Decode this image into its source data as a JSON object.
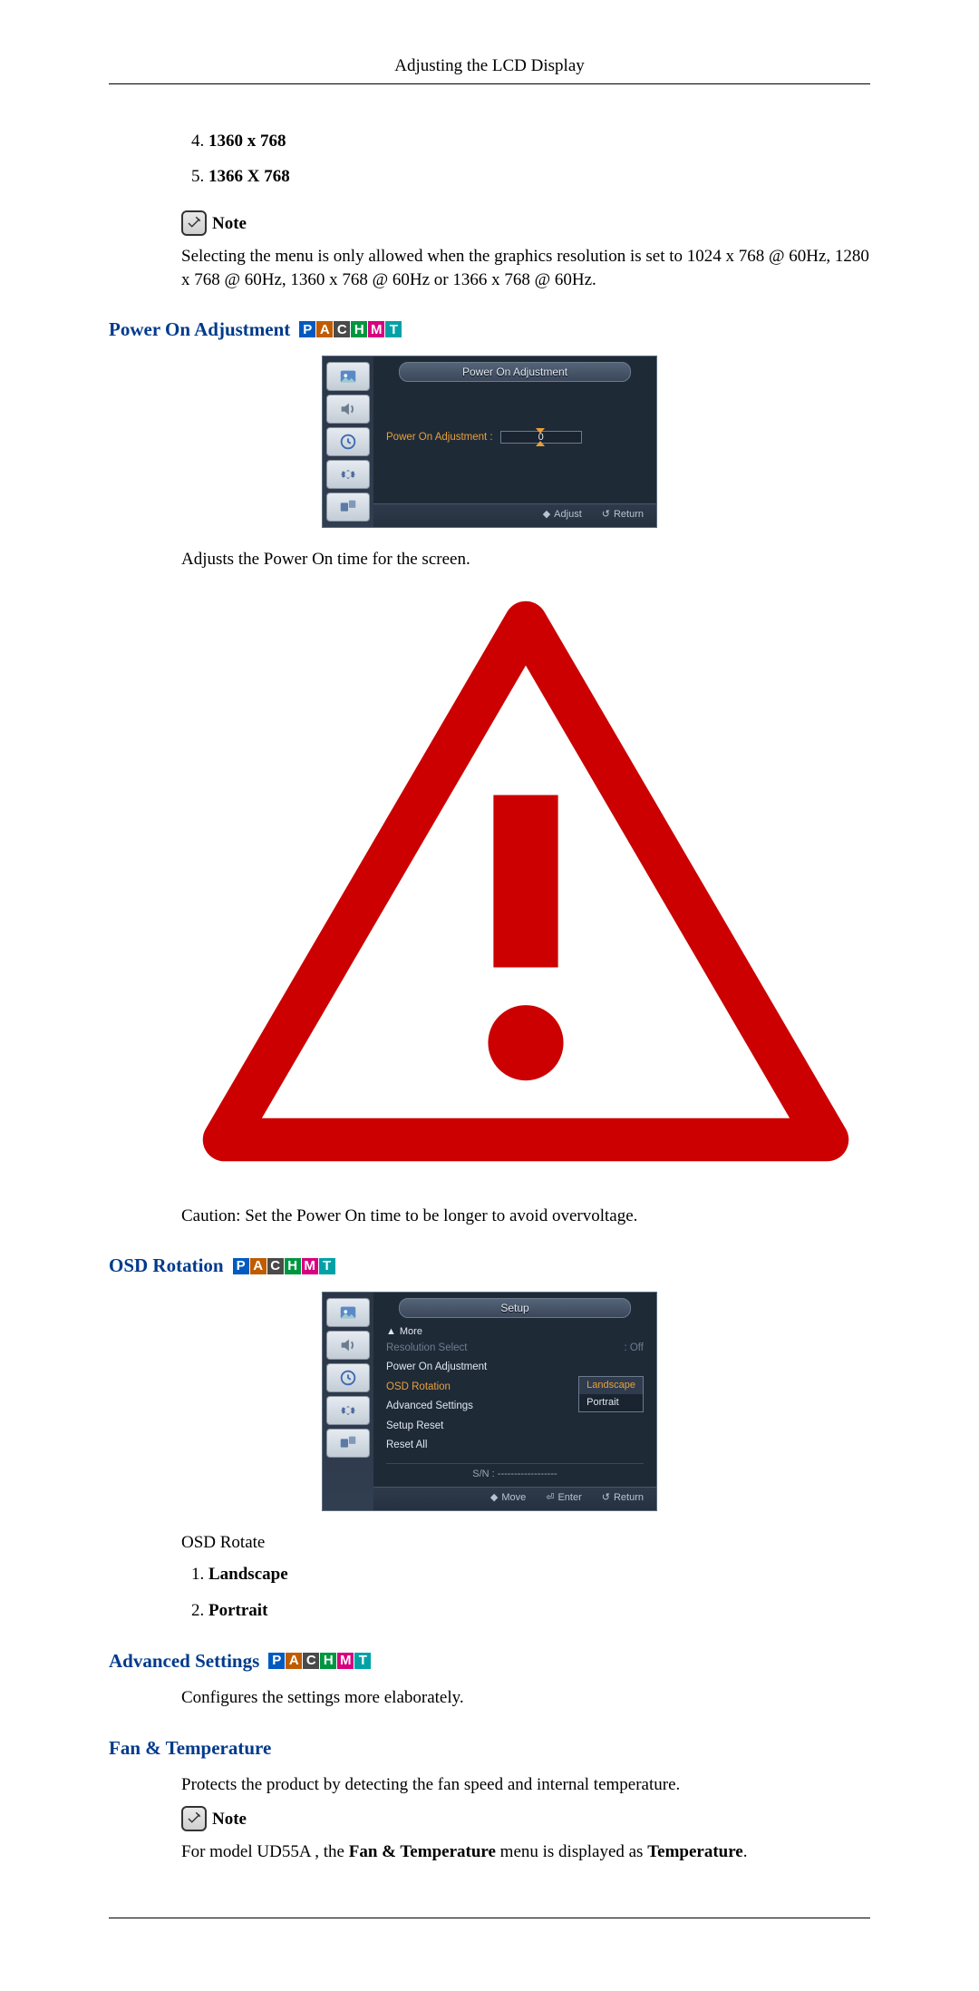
{
  "header": {
    "title": "Adjusting the LCD Display"
  },
  "resolutions": {
    "start_index": 4,
    "items": [
      "1360 x 768",
      "1366 X 768"
    ]
  },
  "note": {
    "label": "Note",
    "text": "Selecting the menu is only allowed when the graphics resolution is set to 1024 x 768 @ 60Hz, 1280 x 768 @ 60Hz, 1360 x 768 @ 60Hz or 1366 x 768 @ 60Hz."
  },
  "badge_letters": [
    "P",
    "A",
    "C",
    "H",
    "M",
    "T"
  ],
  "power_on": {
    "heading": "Power On Adjustment",
    "osd_title": "Power On Adjustment",
    "row_label": "Power On Adjustment :",
    "slider_value": "0",
    "footer": {
      "adjust": "Adjust",
      "return": "Return"
    },
    "desc": "Adjusts the Power On time for the screen.",
    "caution": "Caution: Set the Power On time to be longer to avoid overvoltage."
  },
  "osd_rotation": {
    "heading": "OSD Rotation",
    "osd_title": "Setup",
    "more": "More",
    "menu": [
      {
        "label": "Resolution Select",
        "value": ": Off",
        "dim": true
      },
      {
        "label": "Power On Adjustment",
        "value": "",
        "dim": false
      },
      {
        "label": "OSD Rotation",
        "value": "",
        "dim": false,
        "selected": true
      },
      {
        "label": "Advanced Settings",
        "value": "",
        "dim": false
      },
      {
        "label": "Setup Reset",
        "value": "",
        "dim": false
      },
      {
        "label": "Reset All",
        "value": "",
        "dim": false
      }
    ],
    "options": {
      "sel": "Landscape",
      "alt": "Portrait"
    },
    "sn_label": "S/N :",
    "sn_value": "------------------",
    "footer": {
      "move": "Move",
      "enter": "Enter",
      "return": "Return"
    },
    "rotate_label": "OSD Rotate",
    "list": [
      "Landscape",
      "Portrait"
    ]
  },
  "advanced": {
    "heading": "Advanced Settings",
    "desc": "Configures the settings more elaborately."
  },
  "fan_temp": {
    "heading": "Fan & Temperature",
    "desc": "Protects the product by detecting the fan speed and internal temperature.",
    "note_label": "Note",
    "note_text_prefix": "For model UD55A , the ",
    "note_text_bold1": "Fan & Temperature",
    "note_text_mid": " menu is displayed as ",
    "note_text_bold2": "Temperature",
    "note_text_suffix": "."
  }
}
